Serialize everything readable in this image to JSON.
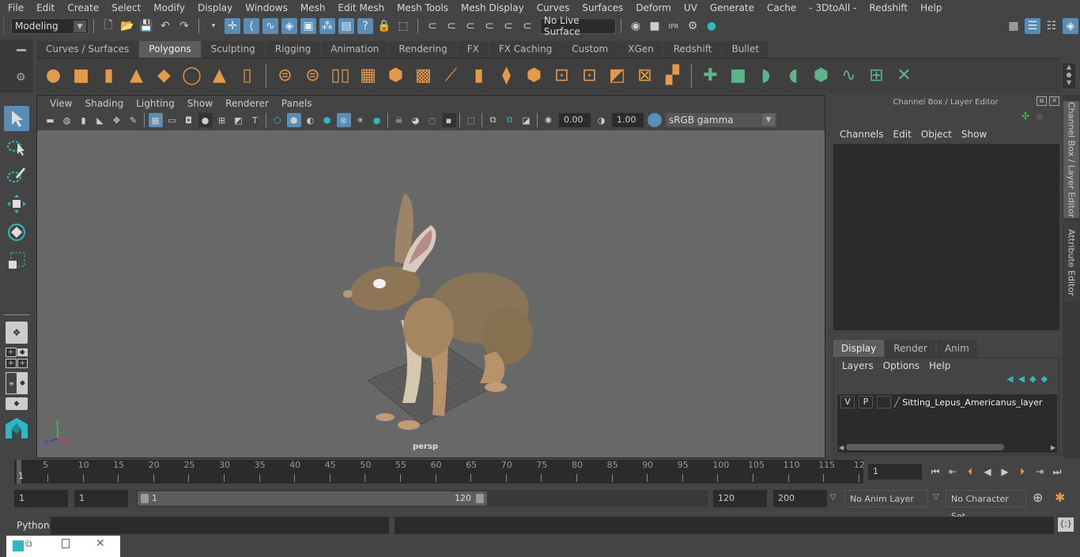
{
  "menubar": [
    "File",
    "Edit",
    "Create",
    "Select",
    "Modify",
    "Display",
    "Windows",
    "Mesh",
    "Edit Mesh",
    "Mesh Tools",
    "Mesh Display",
    "Curves",
    "Surfaces",
    "Deform",
    "UV",
    "Generate",
    "Cache",
    "- 3DtoAll -",
    "Redshift",
    "Help"
  ],
  "status_line": {
    "mode_select": "Modeling",
    "live_surface": "No Live Surface"
  },
  "shelf": {
    "tabs": [
      "Curves / Surfaces",
      "Polygons",
      "Sculpting",
      "Rigging",
      "Animation",
      "Rendering",
      "FX",
      "FX Caching",
      "Custom",
      "XGen",
      "Redshift",
      "Bullet"
    ],
    "active_tab": "Polygons",
    "icons": [
      "poly-sphere-icon",
      "poly-cube-icon",
      "poly-cylinder-icon",
      "poly-cone-icon",
      "poly-plane-icon",
      "poly-torus-icon",
      "poly-pyramid-icon",
      "poly-pipe-icon",
      "combine-icon",
      "separate-icon",
      "mirror-icon",
      "smooth-icon",
      "extrude-icon",
      "bridge-icon",
      "bevel-icon",
      "multi-cut-icon",
      "extrude-face-icon",
      "fill-hole-icon",
      "merge-icon",
      "edge-loop-icon",
      "insert-loop-icon",
      "triangulate-icon",
      "quadrangulate-icon",
      "center-pivot-icon",
      "uv-planar-icon",
      "uv-cylindrical-icon",
      "uv-spherical-icon",
      "uv-automatic-icon",
      "uv-unfold-icon",
      "uv-editor-icon",
      "uv-layout-icon"
    ]
  },
  "viewport": {
    "menu": [
      "View",
      "Shading",
      "Lighting",
      "Show",
      "Renderer",
      "Panels"
    ],
    "exposure": "0.00",
    "gamma": "1.00",
    "color_mgmt_toggle": "ON",
    "color_space": "sRGB gamma",
    "camera_label": "persp",
    "axis_labels": [
      "x",
      "y",
      "z"
    ]
  },
  "channel_box": {
    "title": "Channel Box / Layer Editor",
    "menu": [
      "Channels",
      "Edit",
      "Object",
      "Show"
    ],
    "layer_tabs": [
      "Display",
      "Render",
      "Anim"
    ],
    "active_layer_tab": "Display",
    "layer_menu": [
      "Layers",
      "Options",
      "Help"
    ],
    "layers": [
      {
        "v": "V",
        "p": "P",
        "name": "Sitting_Lepus_Americanus_layer"
      }
    ]
  },
  "side_tabs": [
    "Channel Box / Layer Editor",
    "Attribute Editor"
  ],
  "timeline": {
    "ticks": [
      "5",
      "10",
      "15",
      "20",
      "25",
      "30",
      "35",
      "40",
      "45",
      "50",
      "55",
      "60",
      "65",
      "70",
      "75",
      "80",
      "85",
      "90",
      "95",
      "100",
      "105",
      "110",
      "115",
      "12"
    ],
    "current_marker": "1",
    "current_frame": "1"
  },
  "range": {
    "start": "1",
    "playback_start": "1",
    "slider_start": "1",
    "slider_end": "120",
    "playback_end": "120",
    "end": "200",
    "anim_layer": "No Anim Layer",
    "character_set": "No Character Set"
  },
  "command_line": {
    "language": "Python"
  },
  "colors": {
    "accent_blue": "#5a8db6",
    "poly_orange": "#e59a4a",
    "uv_green": "#5db38a",
    "teal": "#2fb8c4"
  }
}
